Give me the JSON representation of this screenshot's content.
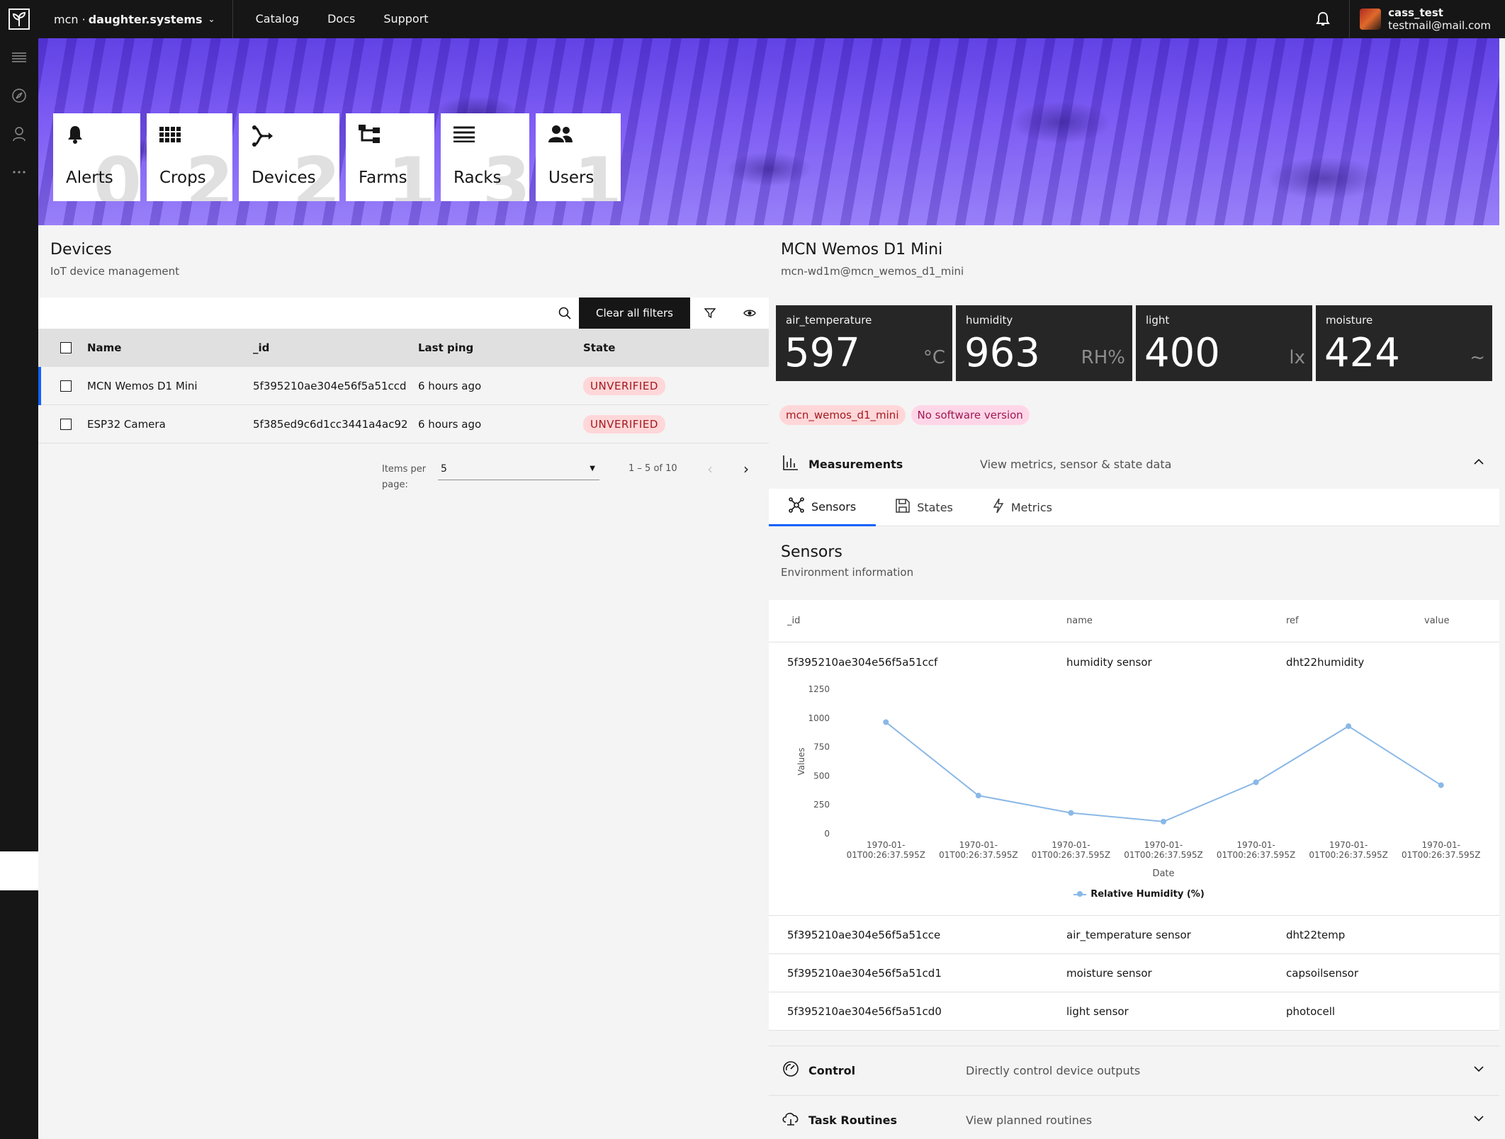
{
  "header": {
    "org_prefix": "mcn ·",
    "org_name": "daughter.systems",
    "nav": [
      "Catalog",
      "Docs",
      "Support"
    ],
    "user_name": "cass_test",
    "user_email": "testmail@mail.com"
  },
  "tiles": [
    {
      "label": "Alerts",
      "count": "0",
      "icon": "bell-icon"
    },
    {
      "label": "Crops",
      "count": "2",
      "icon": "grid-icon"
    },
    {
      "label": "Devices",
      "count": "2",
      "icon": "device-hub-icon"
    },
    {
      "label": "Farms",
      "count": "1",
      "icon": "hierarchy-icon"
    },
    {
      "label": "Racks",
      "count": "3",
      "icon": "list-icon"
    },
    {
      "label": "Users",
      "count": "1",
      "icon": "users-icon"
    }
  ],
  "devices": {
    "title": "Devices",
    "subtitle": "IoT device management",
    "clear_filters": "Clear all filters",
    "columns": [
      "Name",
      "_id",
      "Last ping",
      "State"
    ],
    "rows": [
      {
        "name": "MCN Wemos D1 Mini",
        "id": "5f395210ae304e56f5a51ccd",
        "ping": "6 hours ago",
        "state": "UNVERIFIED"
      },
      {
        "name": "ESP32 Camera",
        "id": "5f385ed9c6d1cc3441a4ac92",
        "ping": "6 hours ago",
        "state": "UNVERIFIED"
      }
    ],
    "pager": {
      "items_per_page_label": "Items per page:",
      "items_per_page": "5",
      "range": "1 – 5 of 10"
    }
  },
  "device_detail": {
    "title": "MCN Wemos D1 Mini",
    "subtitle": "mcn-wd1m@mcn_wemos_d1_mini",
    "metrics": [
      {
        "key": "air_temperature",
        "value": "597",
        "unit": "°C"
      },
      {
        "key": "humidity",
        "value": "963",
        "unit": "RH%"
      },
      {
        "key": "light",
        "value": "400",
        "unit": "lx"
      },
      {
        "key": "moisture",
        "value": "424",
        "unit": "~"
      }
    ],
    "tags": [
      "mcn_wemos_d1_mini",
      "No software version"
    ],
    "measurements": {
      "title": "Measurements",
      "desc": "View metrics, sensor & state data"
    },
    "tabs": [
      "Sensors",
      "States",
      "Metrics"
    ],
    "sensors": {
      "title": "Sensors",
      "subtitle": "Environment information",
      "columns": [
        "_id",
        "name",
        "ref",
        "value"
      ],
      "rows": [
        {
          "id": "5f395210ae304e56f5a51ccf",
          "name": "humidity sensor",
          "ref": "dht22humidity"
        },
        {
          "id": "5f395210ae304e56f5a51cce",
          "name": "air_temperature sensor",
          "ref": "dht22temp"
        },
        {
          "id": "5f395210ae304e56f5a51cd1",
          "name": "moisture sensor",
          "ref": "capsoilsensor"
        },
        {
          "id": "5f395210ae304e56f5a51cd0",
          "name": "light sensor",
          "ref": "photocell"
        }
      ]
    },
    "control": {
      "title": "Control",
      "desc": "Directly control device outputs"
    },
    "routines": {
      "title": "Task Routines",
      "desc": "View planned routines"
    }
  },
  "chart_data": {
    "type": "line",
    "title": "",
    "xlabel": "Date",
    "ylabel": "Values",
    "ylim": [
      0,
      1250
    ],
    "yticks": [
      0,
      250,
      500,
      750,
      1000,
      1250
    ],
    "x": [
      "1970-01-01T00:26:37.595Z",
      "1970-01-01T00:26:37.595Z",
      "1970-01-01T00:26:37.595Z",
      "1970-01-01T00:26:37.595Z",
      "1970-01-01T00:26:37.595Z",
      "1970-01-01T00:26:37.595Z",
      "1970-01-01T00:26:37.595Z"
    ],
    "series": [
      {
        "name": "Relative Humidity (%)",
        "values": [
          965,
          330,
          180,
          105,
          445,
          930,
          420
        ],
        "color": "#8ab8e6"
      }
    ],
    "legend_position": "bottom-center",
    "grid": false
  }
}
